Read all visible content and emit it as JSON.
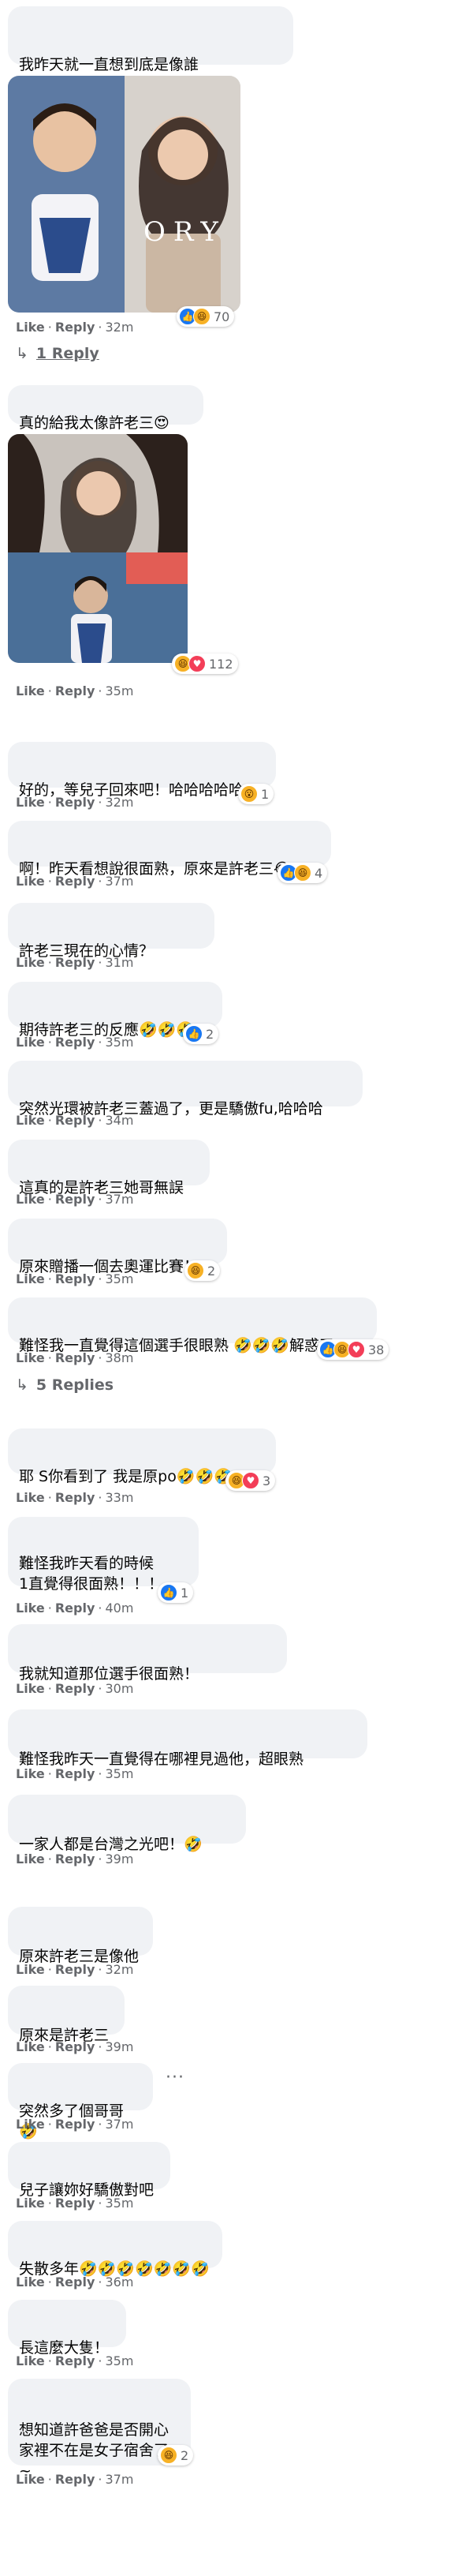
{
  "meta": {
    "like": "Like",
    "reply": "Reply",
    "sep": "·"
  },
  "comments": [
    {
      "text": "我昨天就一直想到底是像誰\n終於解開我的困惑了🤣🤣🤣🤣",
      "time": "32m",
      "reaction_count": "70"
    },
    {
      "text": "真的給我太像許老三😍",
      "time": "35m",
      "reaction_count": "112"
    },
    {
      "text": "好的，等兒子回來吧！哈哈哈哈哈",
      "time": "32m",
      "reaction_count": "1"
    },
    {
      "text": "啊！昨天看想說很面熟，原來是許老三😂",
      "time": "37m",
      "reaction_count": "4"
    },
    {
      "text": "許老三現在的心情？",
      "time": "31m"
    },
    {
      "text": "期待許老三的反應🤣🤣🤣",
      "time": "35m",
      "reaction_count": "2"
    },
    {
      "text": "突然光環被許老三蓋過了，更是驕傲fu,哈哈哈",
      "time": "34m"
    },
    {
      "text": "這真的是許老三她哥無誤",
      "time": "37m"
    },
    {
      "text": "原來贈播一個去奧運比賽！",
      "time": "35m",
      "reaction_count": "2"
    },
    {
      "text": "難怪我一直覺得這個選手很眼熟 🤣🤣🤣解惑了",
      "time": "38m",
      "reaction_count": "38"
    },
    {
      "text": "耶 S你看到了 我是原po🤣🤣🤣",
      "time": "33m",
      "reaction_count": "3"
    },
    {
      "text": "難怪我昨天看的時候\n1直覺得很面熟！！！",
      "time": "40m",
      "reaction_count": "1"
    },
    {
      "text": "我就知道那位選手很面熟！",
      "time": "30m"
    },
    {
      "text": "難怪我昨天一直覺得在哪裡見過他，超眼熟",
      "time": "35m"
    },
    {
      "text": "一家人都是台灣之光吧！🤣",
      "time": "39m"
    },
    {
      "text": "原來許老三是像他",
      "time": "32m"
    },
    {
      "text": "原來是許老三",
      "time": "39m"
    },
    {
      "text": "突然多了個哥哥🤣",
      "time": "37m"
    },
    {
      "text": "兒子讓妳好驕傲對吧",
      "time": "35m"
    },
    {
      "text": "失散多年🤣🤣🤣🤣🤣🤣🤣",
      "time": "36m"
    },
    {
      "text": "長這麼大隻！",
      "time": "35m"
    },
    {
      "text": "想知道許爸爸是否開心\n家裡不在是女子宿舍了~",
      "time": "37m",
      "reaction_count": "2"
    }
  ],
  "replies": {
    "r1": "1 Reply",
    "r2": "5 Replies"
  },
  "icons": {
    "reply_arrow": "reply-arrow-icon",
    "more": "more-options-icon"
  },
  "colors": {
    "bubble": "#f0f2f5",
    "meta": "#65676b",
    "like": "#1877f2",
    "haha": "#f7b125",
    "love": "#f33e58"
  },
  "photos": {
    "p1_watermark": "ORY"
  }
}
